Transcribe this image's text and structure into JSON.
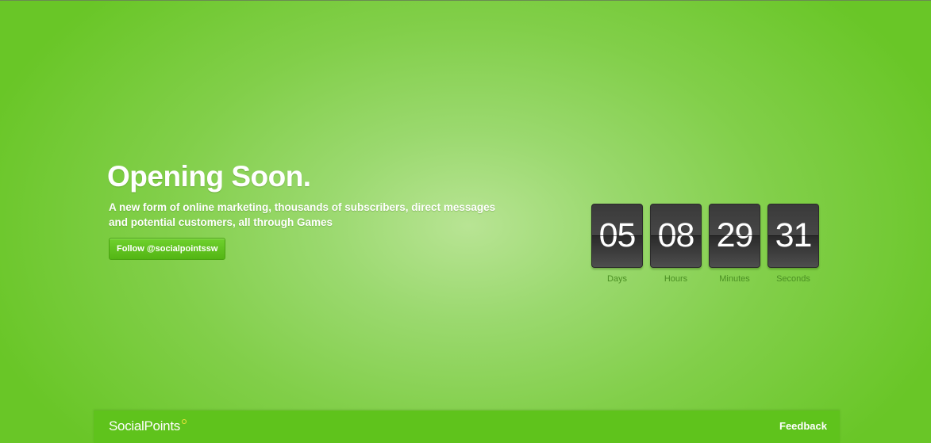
{
  "hero": {
    "title": "Opening Soon.",
    "description": "A new form of online marketing, thousands of subscribers, direct messages and potential customers, all through Games",
    "follow_button": "Follow @socialpointssw"
  },
  "countdown": [
    {
      "value": "05",
      "label": "Days"
    },
    {
      "value": "08",
      "label": "Hours"
    },
    {
      "value": "29",
      "label": "Minutes"
    },
    {
      "value": "31",
      "label": "Seconds"
    }
  ],
  "footer": {
    "brand": "SocialPoints",
    "feedback": "Feedback"
  },
  "colors": {
    "background": "#82cf4a",
    "footer": "#5fc31c",
    "button": "#5cbf1d",
    "counter": "#3a3a3a",
    "label": "#4b8f24",
    "brand_dot": "#f1e53a"
  }
}
